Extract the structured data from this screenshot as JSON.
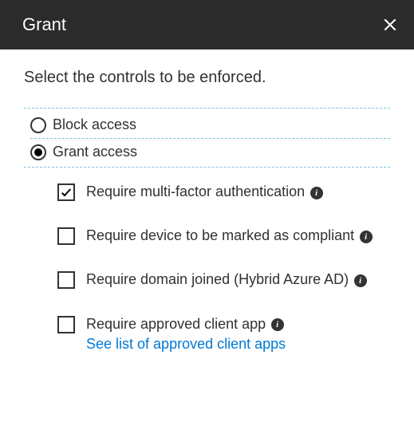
{
  "header": {
    "title": "Grant"
  },
  "intro": "Select the controls to be enforced.",
  "access_mode": {
    "selected": "grant",
    "options": {
      "block": {
        "label": "Block access"
      },
      "grant": {
        "label": "Grant access"
      }
    }
  },
  "controls": [
    {
      "id": "mfa",
      "label": "Require multi-factor authentication",
      "checked": true,
      "has_info": true
    },
    {
      "id": "compliant",
      "label": "Require device to be marked as compliant",
      "checked": false,
      "has_info": true
    },
    {
      "id": "domain",
      "label": "Require domain joined (Hybrid Azure AD)",
      "checked": false,
      "has_info": true
    },
    {
      "id": "approved_app",
      "label": "Require approved client app",
      "checked": false,
      "has_info": true,
      "link": "See list of approved client apps"
    }
  ],
  "info_char": "i"
}
